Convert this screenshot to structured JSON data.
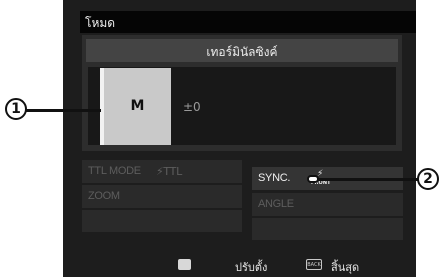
{
  "header": {
    "title": "โหมด"
  },
  "section": {
    "heading": "เทอร์มินัลซิงค์"
  },
  "flash_mode": {
    "mode": "M",
    "compensation": "±0"
  },
  "settings": {
    "ttl_mode": {
      "label": "TTL MODE",
      "value": "⚡TTL"
    },
    "zoom": {
      "label": "ZOOM"
    },
    "sync": {
      "label": "SYNC.",
      "icon": "front-curtain-sync-icon",
      "icon_bolt": "⚡",
      "icon_text": "FRONT"
    },
    "angle": {
      "label": "ANGLE"
    }
  },
  "footer": {
    "adjust_icon": "adjust-icon",
    "adjust_label": "ปรับตั้ง",
    "back_key": "BACK",
    "finish_label": "สิ้นสุด"
  },
  "callouts": {
    "one": "1",
    "two": "2"
  },
  "colors": {
    "background": "#1d1d1d",
    "panel": "#2d2d2d",
    "tile": "#c9c9c9",
    "dim_text": "#5d5d5d"
  }
}
